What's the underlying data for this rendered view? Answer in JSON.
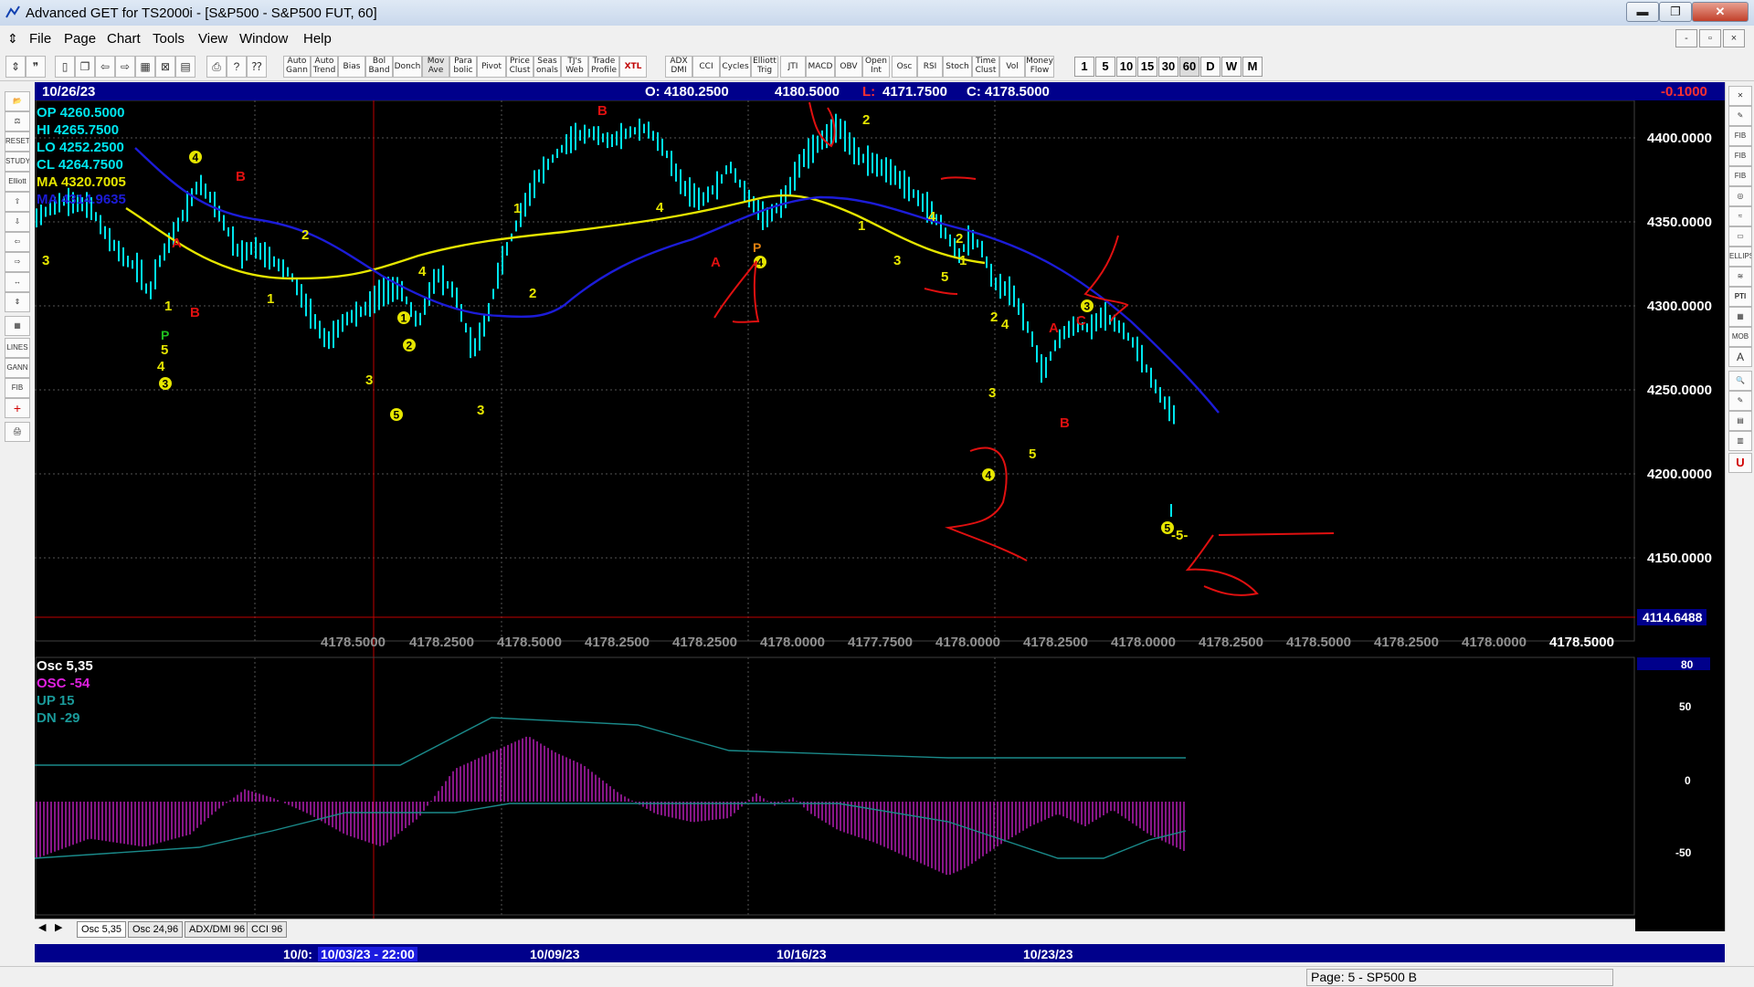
{
  "window": {
    "title": "Advanced GET for TS2000i - [S&P500 - S&P500 FUT, 60]",
    "minimize": "▬",
    "maximize": "❐",
    "close": "✕"
  },
  "menu": {
    "items": [
      "File",
      "Page",
      "Chart",
      "Tools",
      "View",
      "Window",
      "Help"
    ],
    "mdi_buttons": [
      "-",
      "▫",
      "×"
    ]
  },
  "toolbar": {
    "buttons": [
      "Auto Gann",
      "Auto Trend",
      "Bias",
      "Bol Band",
      "Donch",
      "Mov Ave",
      "Para bolic",
      "Pivot",
      "Price Clust",
      "Seas onals",
      "TJ's Web",
      "Trade Profile",
      "XTL",
      "ADX DMI",
      "CCI",
      "Cycles",
      "Elliott Trig",
      "JTI",
      "MACD",
      "OBV",
      "Open Int",
      "Osc",
      "RSI",
      "Stoch",
      "Time Clust",
      "Vol",
      "Money Flow"
    ],
    "periods": [
      "1",
      "5",
      "10",
      "15",
      "30",
      "60",
      "D",
      "W",
      "M"
    ]
  },
  "left_tools": [
    "📂",
    "⚖",
    "RESET",
    "STUDY",
    "Elliott",
    "⇧",
    "⇩",
    "⇦",
    "⇨",
    "↔",
    "⇕",
    "▦",
    "LINES",
    "GANN",
    "FIB",
    "+",
    "🖨"
  ],
  "right_tools": [
    "✕",
    "✎",
    "FIB RET",
    "FIB EXT",
    "FIB TIME",
    "◎",
    "≈",
    "▭",
    "ELLIPS",
    "≋",
    "PTI",
    "▦",
    "MOB",
    "A",
    "🔍",
    "✎",
    "▤",
    "▥",
    "U"
  ],
  "status": {
    "date": "10/26/23",
    "ohlc_O": "O: 4180.2500",
    "ohlc_H": "4180.5000",
    "ohlc_L": "L:",
    "ohlc_L_val": "4171.7500",
    "ohlc_C": "C:  4178.5000",
    "change": "-0.1000"
  },
  "info": {
    "op": "OP  4260.5000",
    "hi": "HI   4265.7500",
    "lo": "LO   4252.2500",
    "cl": "CL   4264.7500",
    "ma1": "MA  4320.7005",
    "ma2": "MA  4314.9635"
  },
  "price_axis": {
    "labels": [
      "4400.0000",
      "4350.0000",
      "4300.0000",
      "4250.0000",
      "4200.0000",
      "4150.0000"
    ],
    "cursor": "4114.6488",
    "last": "4178.5000"
  },
  "bottom_prices": [
    "4178.5000",
    "4178.2500",
    "4178.5000",
    "4178.2500",
    "4178.2500",
    "4178.0000",
    "4177.7500",
    "4178.0000",
    "4178.2500",
    "4178.0000",
    "4178.2500",
    "4178.5000",
    "4178.2500",
    "4178.0000"
  ],
  "osc": {
    "title": "Osc 5,35",
    "osc": "OSC -54",
    "up": "UP   15",
    "dn": "DN   -29",
    "axis": [
      "80",
      "50",
      "0",
      "-50"
    ]
  },
  "tabs": [
    "Osc 5,35",
    "Osc 24,96",
    "ADX/DMI 96",
    "CCI 96"
  ],
  "dates": {
    "d1": "10/0:",
    "cursor": "10/03/23 - 22:00",
    "d2": "10/09/23",
    "d3": "10/16/23",
    "d4": "10/23/23"
  },
  "statusbar": {
    "page": "Page: 5 - SP500 B"
  },
  "elliott_labels": {
    "yellow": [
      "3",
      "4",
      "2",
      "1",
      "3",
      "1",
      "2",
      "4",
      "1",
      "2",
      "1",
      "2",
      "4",
      "3",
      "4",
      "5",
      "1",
      "2",
      "3",
      "4",
      "3",
      "5",
      "5",
      "-5-"
    ],
    "red": [
      "A",
      "B",
      "B",
      "A",
      "A",
      "B",
      "B",
      "C",
      "B"
    ],
    "circled": [
      "3",
      "5",
      "1",
      "2",
      "4",
      "4",
      "3",
      "4",
      "5"
    ]
  },
  "colors": {
    "background": "#000000",
    "price_bars": "#00e5ee",
    "ma_yellow": "#e6e600",
    "ma_blue": "#1c1cd8",
    "osc_histogram": "#c020c0",
    "osc_line": "#1a8a8a",
    "annotation_red": "#e01010",
    "label_panel": "#00008b"
  }
}
